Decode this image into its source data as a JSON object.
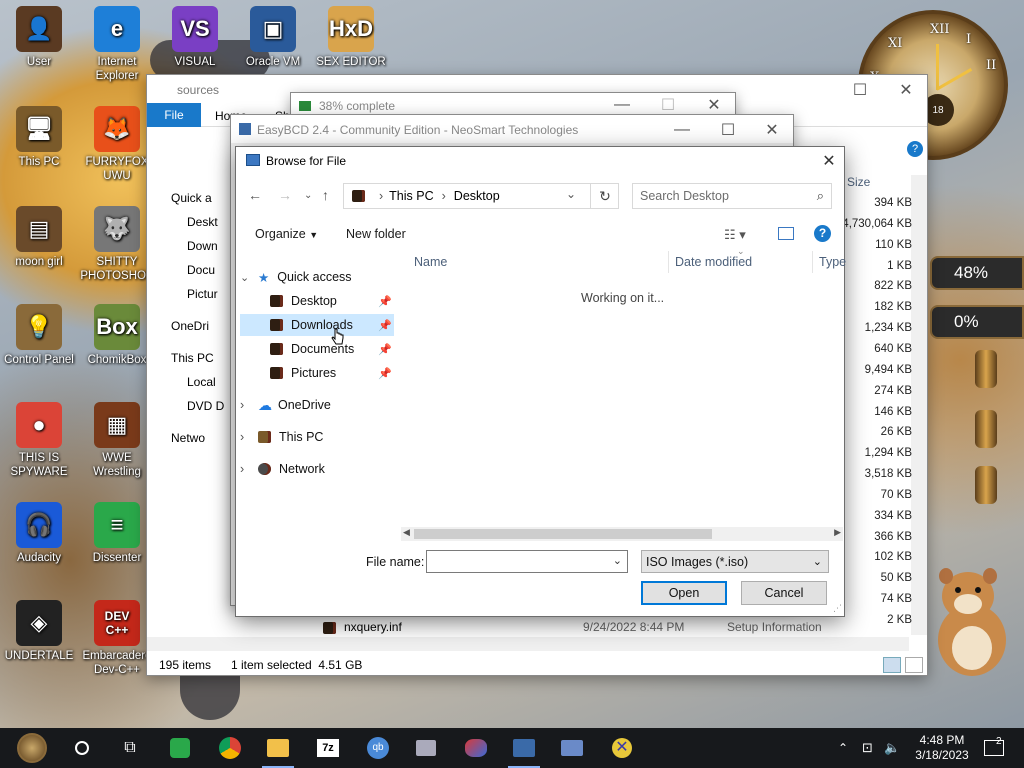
{
  "desktop": {
    "icons": [
      {
        "label": "User",
        "glyph": "👤",
        "color": "#5a3a22"
      },
      {
        "label": "Internet Explorer",
        "glyph": "e",
        "color": "#1e7fd8"
      },
      {
        "label": "VISUAL",
        "glyph": "VS",
        "color": "#7a3fc4"
      },
      {
        "label": "Oracle VM",
        "glyph": "▣",
        "color": "#2a5a9a"
      },
      {
        "label": "SEX EDITOR",
        "glyph": "HxD",
        "color": "#d9a44c"
      },
      {
        "label": "This PC",
        "glyph": "🖥",
        "color": "#7a5a2a"
      },
      {
        "label": "FURRYFOX UWU",
        "glyph": "🦊",
        "color": "#e8501a"
      },
      {
        "label": "moon girl",
        "glyph": "▤",
        "color": "#6a4a2a"
      },
      {
        "label": "SHITTY PHOTOSHOP",
        "glyph": "🐺",
        "color": "#777"
      },
      {
        "label": "Control Panel",
        "glyph": "💡",
        "color": "#8a6a3a"
      },
      {
        "label": "ChomikBox",
        "glyph": "Box",
        "color": "#6a8a3a"
      },
      {
        "label": "THIS IS SPYWARE",
        "glyph": "●",
        "color": "#db4437"
      },
      {
        "label": "WWE Wrestling",
        "glyph": "▦",
        "color": "#7a3a1a"
      },
      {
        "label": "Audacity",
        "glyph": "🎧",
        "color": "#1a5ad8"
      },
      {
        "label": "Dissenter",
        "glyph": "≡",
        "color": "#2aa84a"
      },
      {
        "label": "UNDERTALE",
        "glyph": "◈",
        "color": "#222"
      },
      {
        "label": "Embarcadero Dev-C++",
        "glyph": "DEV C++",
        "color": "#c4281a"
      }
    ],
    "gauges": [
      "48%",
      "0%"
    ],
    "clock": {
      "numerals": [
        "XII",
        "I",
        "II",
        "X",
        "XI"
      ],
      "center": "18"
    }
  },
  "explorer": {
    "title": "sources",
    "file_tab": "File",
    "tabs": [
      "Home",
      "Sh"
    ],
    "size_header": "Size",
    "sizes": [
      "394 KB",
      "4,730,064 KB",
      "110 KB",
      "1 KB",
      "822 KB",
      "182 KB",
      "1,234 KB",
      "640 KB",
      "9,494 KB",
      "274 KB",
      "146 KB",
      "26 KB",
      "1,294 KB",
      "3,518 KB",
      "70 KB",
      "334 KB",
      "366 KB",
      "102 KB",
      "50 KB",
      "74 KB",
      "2 KB"
    ],
    "nav": [
      "Quick a",
      "Deskt",
      "Down",
      "Docu",
      "Pictur",
      "OneDri",
      "This PC",
      "Local",
      "DVD D",
      "Netwo"
    ],
    "bottom_file": {
      "name": "nxquery.inf",
      "date": "9/24/2022 8:44 PM",
      "type": "Setup Information"
    },
    "status": {
      "items": "195 items",
      "selected": "1 item selected  4.51 GB"
    }
  },
  "progress_window": {
    "title": "38% complete"
  },
  "easybcd": {
    "title": "EasyBCD 2.4 - Community Edition - NeoSmart Technologies"
  },
  "dialog": {
    "title": "Browse for File",
    "breadcrumb": [
      "This PC",
      "Desktop"
    ],
    "search_placeholder": "Search Desktop",
    "organize": "Organize",
    "new_folder": "New folder",
    "tree": {
      "quick_access": "Quick access",
      "items": [
        "Desktop",
        "Downloads",
        "Documents",
        "Pictures"
      ],
      "onedrive": "OneDrive",
      "this_pc": "This PC",
      "network": "Network"
    },
    "columns": {
      "name": "Name",
      "date": "Date modified",
      "type": "Type"
    },
    "status": "Working on it...",
    "file_name_label": "File name:",
    "file_name_value": "",
    "filter": "ISO Images (*.iso)",
    "open": "Open",
    "cancel": "Cancel"
  },
  "taskbar": {
    "time": "4:48 PM",
    "date": "3/18/2023",
    "notifications": "2"
  },
  "colors": {
    "accent": "#0078d7",
    "selection": "#cce8ff",
    "taskbar": "#17191c"
  }
}
